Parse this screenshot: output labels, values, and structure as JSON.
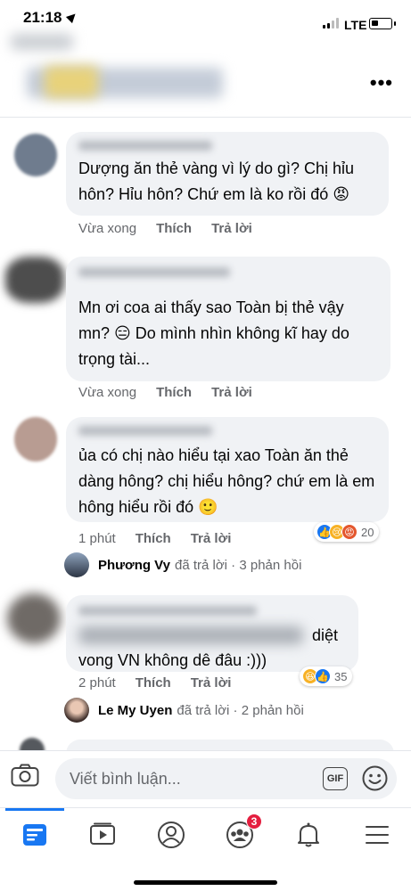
{
  "status_bar": {
    "time": "21:18",
    "network": "LTE",
    "battery_level": 0.35
  },
  "header": {
    "more_icon": "more-horizontal-icon"
  },
  "comments": [
    {
      "text": "Dượng ăn thẻ vàng vì lý do gì? Chị hỉu hôn? Hỉu hôn? Chứ em là ko rồi đó 😡",
      "time": "Vừa xong",
      "like_label": "Thích",
      "reply_label": "Trả lời"
    },
    {
      "text": "Mn ơi coa ai thấy sao Toàn bị thẻ vậy mn? 😑 Do mình nhìn không kĩ hay do trọng tài...",
      "time": "Vừa xong",
      "like_label": "Thích",
      "reply_label": "Trả lời"
    },
    {
      "text": "ủa có chị nào hiểu tại xao Toàn ăn thẻ dàng hông? chị hiểu hông? chứ em là em hông hiểu rồi đó 🙂",
      "time": "1 phút",
      "like_label": "Thích",
      "reply_label": "Trả lời",
      "reaction_count": "20",
      "reply_user": "Phương Vy",
      "reply_summary": "đã trả lời · 3 phản hồi"
    },
    {
      "text_visible_end": "diệt",
      "text_line2": "vong VN không dê đâu :)))",
      "time": "2 phút",
      "like_label": "Thích",
      "reply_label": "Trả lời",
      "reaction_count": "35",
      "reply_user": "Le My Uyen",
      "reply_summary": "đã trả lời · 2 phản hồi"
    }
  ],
  "composer": {
    "placeholder": "Viết bình luận...",
    "gif_label": "GIF"
  },
  "tabbar": {
    "tabs": [
      "news-feed",
      "watch",
      "profile",
      "groups",
      "notifications",
      "menu"
    ],
    "groups_badge": "3"
  },
  "colors": {
    "accent": "#1877f2",
    "bubble": "#f0f2f5",
    "secondary_text": "#65676b",
    "badge": "#e41e3f"
  }
}
